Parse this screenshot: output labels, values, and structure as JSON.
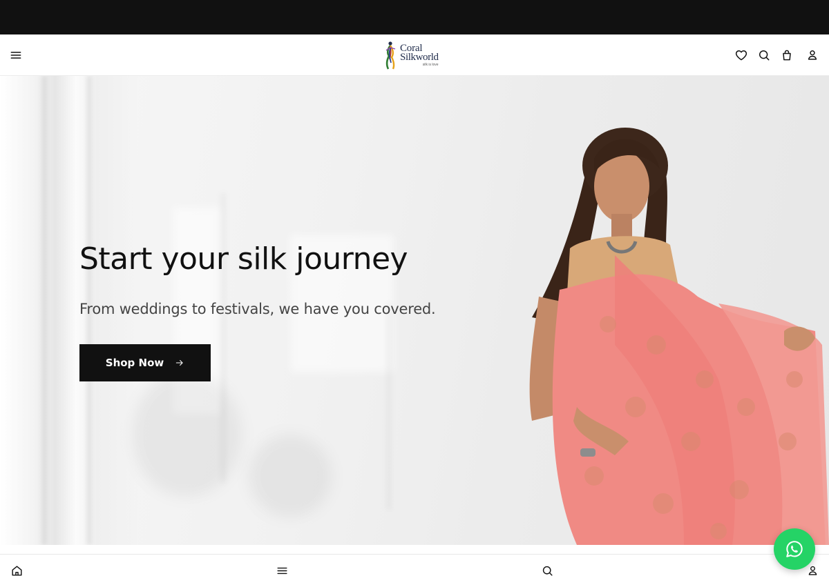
{
  "brand": {
    "name_line1": "Coral",
    "name_line2": "Silkworld",
    "tagline": "silk is love"
  },
  "header": {
    "icons": [
      "menu-icon",
      "heart-icon",
      "search-icon",
      "bag-icon",
      "user-icon"
    ]
  },
  "hero": {
    "title": "Start your silk journey",
    "subtitle": "From weddings to festivals, we have you covered.",
    "cta_label": "Shop Now"
  },
  "bottom_nav": {
    "icons": [
      "home-icon",
      "menu-icon",
      "search-icon",
      "user-icon"
    ]
  },
  "whatsapp": {
    "icon": "whatsapp-icon",
    "color": "#25d366"
  },
  "colors": {
    "topbar": "#111111",
    "cta_bg": "#111111",
    "saree": "#f08a84"
  }
}
